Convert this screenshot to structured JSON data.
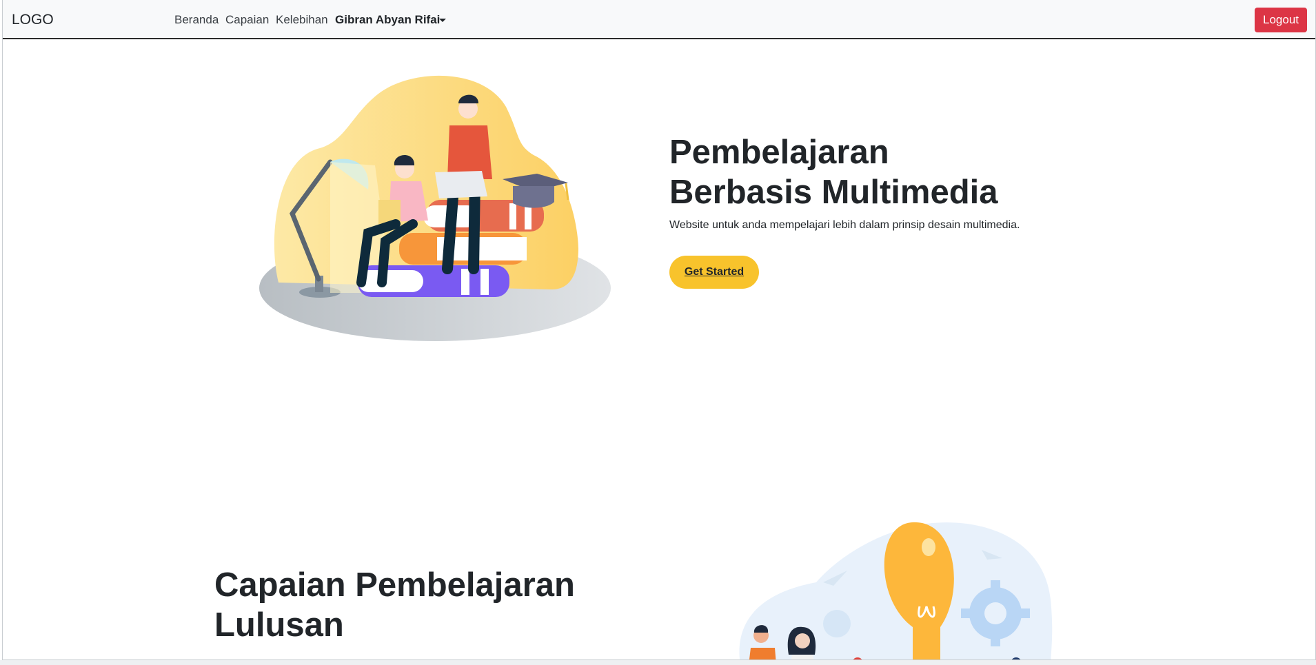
{
  "navbar": {
    "brand": "LOGO",
    "links": [
      "Beranda",
      "Capaian",
      "Kelebihan"
    ],
    "user_name": "Gibran Abyan Rifai",
    "logout_label": "Logout"
  },
  "hero": {
    "title_line1": "Pembelajaran",
    "title_line2": "Berbasis Multimedia",
    "subtitle": "Website untuk anda mempelajari lebih dalam prinsip desain multimedia.",
    "cta_label": "Get Started"
  },
  "section2": {
    "title_line1": "Capaian Pembelajaran",
    "title_line2": "Lulusan"
  },
  "colors": {
    "navbar_bg": "#f8f9fa",
    "logout": "#dc3545",
    "cta": "#f8c32c",
    "text": "#212529"
  }
}
